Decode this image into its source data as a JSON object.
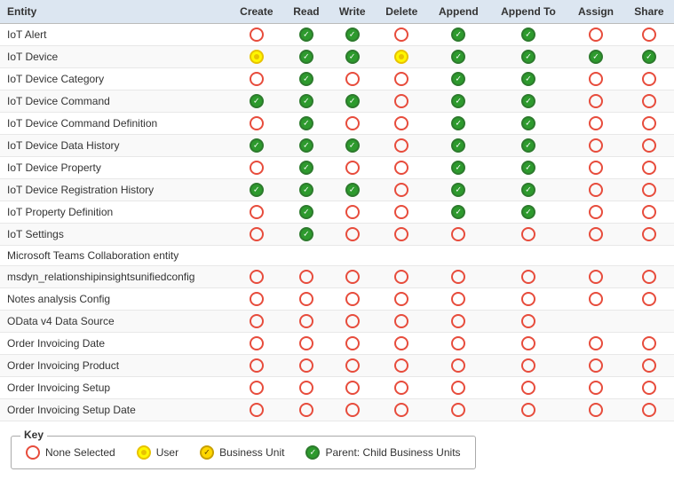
{
  "table": {
    "columns": [
      "Entity",
      "Create",
      "Read",
      "Write",
      "Delete",
      "Append",
      "Append To",
      "Assign",
      "Share"
    ],
    "rows": [
      {
        "entity": "IoT Alert",
        "create": "none",
        "read": "parent",
        "write": "parent",
        "delete": "none",
        "append": "parent",
        "appendTo": "parent",
        "assign": "none",
        "share": "none"
      },
      {
        "entity": "IoT Device",
        "create": "user",
        "read": "parent",
        "write": "parent",
        "delete": "user",
        "append": "parent",
        "appendTo": "parent",
        "assign": "parent",
        "share": "parent"
      },
      {
        "entity": "IoT Device Category",
        "create": "none",
        "read": "parent",
        "write": "none",
        "delete": "none",
        "append": "parent",
        "appendTo": "parent",
        "assign": "none",
        "share": "none"
      },
      {
        "entity": "IoT Device Command",
        "create": "parent",
        "read": "parent",
        "write": "parent",
        "delete": "none",
        "append": "parent",
        "appendTo": "parent",
        "assign": "none",
        "share": "none"
      },
      {
        "entity": "IoT Device Command Definition",
        "create": "none",
        "read": "parent",
        "write": "none",
        "delete": "none",
        "append": "parent",
        "appendTo": "parent",
        "assign": "none",
        "share": "none"
      },
      {
        "entity": "IoT Device Data History",
        "create": "parent",
        "read": "parent",
        "write": "parent",
        "delete": "none",
        "append": "parent",
        "appendTo": "parent",
        "assign": "none",
        "share": "none"
      },
      {
        "entity": "IoT Device Property",
        "create": "none",
        "read": "parent",
        "write": "none",
        "delete": "none",
        "append": "parent",
        "appendTo": "parent",
        "assign": "none",
        "share": "none"
      },
      {
        "entity": "IoT Device Registration History",
        "create": "parent",
        "read": "parent",
        "write": "parent",
        "delete": "none",
        "append": "parent",
        "appendTo": "parent",
        "assign": "none",
        "share": "none"
      },
      {
        "entity": "IoT Property Definition",
        "create": "none",
        "read": "parent",
        "write": "none",
        "delete": "none",
        "append": "parent",
        "appendTo": "parent",
        "assign": "none",
        "share": "none"
      },
      {
        "entity": "IoT Settings",
        "create": "none",
        "read": "parent",
        "write": "none",
        "delete": "none",
        "append": "none",
        "appendTo": "none",
        "assign": "none",
        "share": "none"
      },
      {
        "entity": "Microsoft Teams Collaboration entity",
        "create": "",
        "read": "",
        "write": "",
        "delete": "",
        "append": "",
        "appendTo": "",
        "assign": "",
        "share": ""
      },
      {
        "entity": "msdyn_relationshipinsightsunifiedconfig",
        "create": "none",
        "read": "none",
        "write": "none",
        "delete": "none",
        "append": "none",
        "appendTo": "none",
        "assign": "none",
        "share": "none"
      },
      {
        "entity": "Notes analysis Config",
        "create": "none",
        "read": "none",
        "write": "none",
        "delete": "none",
        "append": "none",
        "appendTo": "none",
        "assign": "none",
        "share": "none"
      },
      {
        "entity": "OData v4 Data Source",
        "create": "none",
        "read": "none",
        "write": "none",
        "delete": "none",
        "append": "none",
        "appendTo": "none",
        "assign": "",
        "share": ""
      },
      {
        "entity": "Order Invoicing Date",
        "create": "none",
        "read": "none",
        "write": "none",
        "delete": "none",
        "append": "none",
        "appendTo": "none",
        "assign": "none",
        "share": "none"
      },
      {
        "entity": "Order Invoicing Product",
        "create": "none",
        "read": "none",
        "write": "none",
        "delete": "none",
        "append": "none",
        "appendTo": "none",
        "assign": "none",
        "share": "none"
      },
      {
        "entity": "Order Invoicing Setup",
        "create": "none",
        "read": "none",
        "write": "none",
        "delete": "none",
        "append": "none",
        "appendTo": "none",
        "assign": "none",
        "share": "none"
      },
      {
        "entity": "Order Invoicing Setup Date",
        "create": "none",
        "read": "none",
        "write": "none",
        "delete": "none",
        "append": "none",
        "appendTo": "none",
        "assign": "none",
        "share": "none"
      }
    ]
  },
  "key": {
    "label": "Key",
    "items": [
      {
        "type": "none",
        "label": "None Selected"
      },
      {
        "type": "user",
        "label": "User"
      },
      {
        "type": "business",
        "label": "Business Unit"
      },
      {
        "type": "parent",
        "label": "Parent: Child Business Units"
      }
    ]
  }
}
